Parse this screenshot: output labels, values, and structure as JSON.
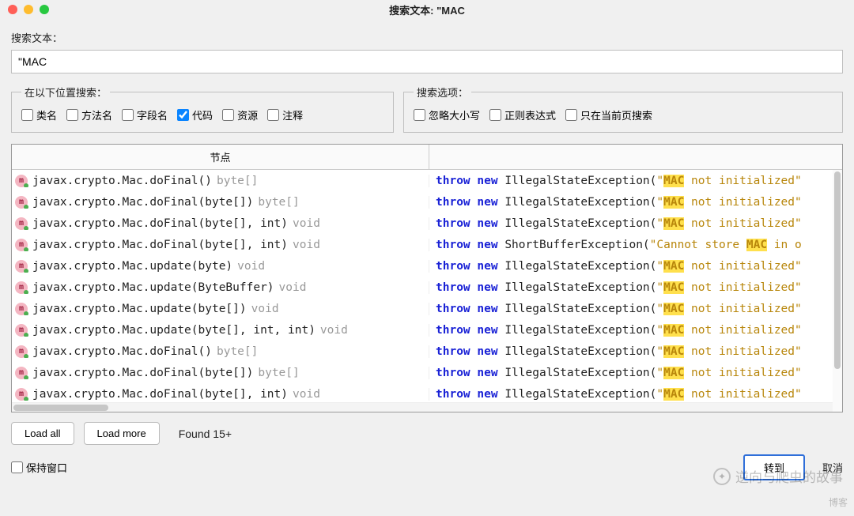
{
  "window": {
    "title": "搜索文本: \"MAC"
  },
  "search": {
    "label": "搜索文本：",
    "value": "\"MAC"
  },
  "scopes": {
    "legend": "在以下位置搜索：",
    "items": [
      {
        "label": "类名",
        "checked": false
      },
      {
        "label": "方法名",
        "checked": false
      },
      {
        "label": "字段名",
        "checked": false
      },
      {
        "label": "代码",
        "checked": true
      },
      {
        "label": "资源",
        "checked": false
      },
      {
        "label": "注释",
        "checked": false
      }
    ]
  },
  "options": {
    "legend": "搜索选项：",
    "items": [
      {
        "label": "忽略大小写",
        "checked": false
      },
      {
        "label": "正则表达式",
        "checked": false
      },
      {
        "label": "只在当前页搜索",
        "checked": false
      }
    ]
  },
  "table": {
    "header_node": "节点",
    "rows": [
      {
        "sig": "javax.crypto.Mac.doFinal()",
        "ret": "byte[]",
        "throw": "throw",
        "new": "new",
        "exc": "IllegalStateException(",
        "pre": "\"",
        "mac": "MAC",
        "post": " not initialized\""
      },
      {
        "sig": "javax.crypto.Mac.doFinal(byte[])",
        "ret": "byte[]",
        "throw": "throw",
        "new": "new",
        "exc": "IllegalStateException(",
        "pre": "\"",
        "mac": "MAC",
        "post": " not initialized\""
      },
      {
        "sig": "javax.crypto.Mac.doFinal(byte[], int)",
        "ret": "void",
        "throw": "throw",
        "new": "new",
        "exc": "IllegalStateException(",
        "pre": "\"",
        "mac": "MAC",
        "post": " not initialized\""
      },
      {
        "sig": "javax.crypto.Mac.doFinal(byte[], int)",
        "ret": "void",
        "throw": "throw",
        "new": "new",
        "exc": "ShortBufferException(",
        "pre": "\"Cannot store ",
        "mac": "MAC",
        "post": " in o"
      },
      {
        "sig": "javax.crypto.Mac.update(byte)",
        "ret": "void",
        "throw": "throw",
        "new": "new",
        "exc": "IllegalStateException(",
        "pre": "\"",
        "mac": "MAC",
        "post": " not initialized\""
      },
      {
        "sig": "javax.crypto.Mac.update(ByteBuffer)",
        "ret": "void",
        "throw": "throw",
        "new": "new",
        "exc": "IllegalStateException(",
        "pre": "\"",
        "mac": "MAC",
        "post": " not initialized\""
      },
      {
        "sig": "javax.crypto.Mac.update(byte[])",
        "ret": "void",
        "throw": "throw",
        "new": "new",
        "exc": "IllegalStateException(",
        "pre": "\"",
        "mac": "MAC",
        "post": " not initialized\""
      },
      {
        "sig": "javax.crypto.Mac.update(byte[], int, int)",
        "ret": "void",
        "throw": "throw",
        "new": "new",
        "exc": "IllegalStateException(",
        "pre": "\"",
        "mac": "MAC",
        "post": " not initialized\""
      },
      {
        "sig": "javax.crypto.Mac.doFinal()",
        "ret": "byte[]",
        "throw": "throw",
        "new": "new",
        "exc": "IllegalStateException(",
        "pre": "\"",
        "mac": "MAC",
        "post": " not initialized\""
      },
      {
        "sig": "javax.crypto.Mac.doFinal(byte[])",
        "ret": "byte[]",
        "throw": "throw",
        "new": "new",
        "exc": "IllegalStateException(",
        "pre": "\"",
        "mac": "MAC",
        "post": " not initialized\""
      },
      {
        "sig": "javax.crypto.Mac.doFinal(byte[], int)",
        "ret": "void",
        "throw": "throw",
        "new": "new",
        "exc": "IllegalStateException(",
        "pre": "\"",
        "mac": "MAC",
        "post": " not initialized\""
      }
    ]
  },
  "footer": {
    "load_all": "Load all",
    "load_more": "Load more",
    "found": "Found 15+",
    "keep_window": "保持窗口",
    "goto": "转到",
    "cancel": "取消"
  },
  "watermark": {
    "text": "逆向与爬虫的故事",
    "blog": "博客"
  }
}
